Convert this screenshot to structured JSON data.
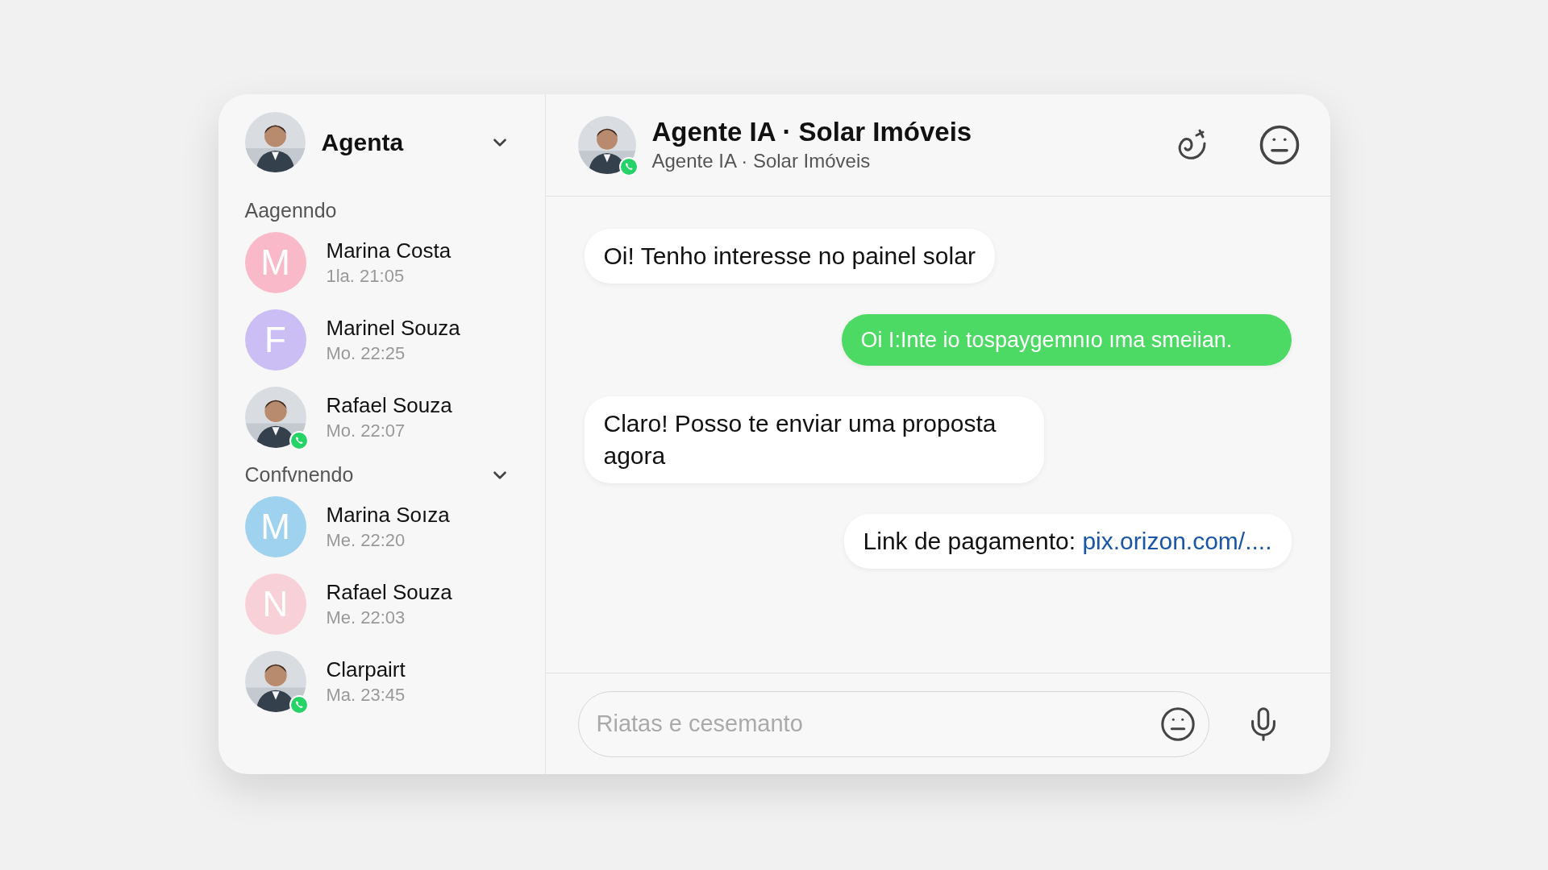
{
  "account": {
    "name": "Agenta",
    "expanded": true
  },
  "sections": [
    {
      "title": "Aagenndo",
      "contacts": [
        {
          "name": "Marina Costa",
          "time": "1la. 21:05",
          "kind": "letter",
          "initial": "M",
          "color": "#f9b9c8",
          "whatsapp": false
        },
        {
          "name": "Marinel Souza",
          "time": "Mo. 22:25",
          "kind": "letter",
          "initial": "F",
          "color": "#cbbef5",
          "whatsapp": false
        },
        {
          "name": "Rafael Souza",
          "time": "Mo. 22:07",
          "whatsapp": true
        }
      ]
    },
    {
      "title": "Confvnendo",
      "expanded": true,
      "contacts": [
        {
          "name": "Marina Soıza",
          "time": "Me. 22:20",
          "kind": "letter",
          "initial": "M",
          "color": "#9fd2ef",
          "whatsapp": false
        },
        {
          "name": "Rafael Souza",
          "time": "Me. 22:03",
          "kind": "letter",
          "initial": "N",
          "color": "#f8d0d8",
          "whatsapp": false
        },
        {
          "name": "Clarpairt",
          "time": "Ma. 23:45",
          "whatsapp": true
        }
      ]
    }
  ],
  "chat": {
    "title": "Agente IA · Solar Imóveis",
    "subtitle": "Agente IA · Solar Imóveis",
    "whatsapp": true
  },
  "messages": [
    {
      "kind": "incoming",
      "text": "Oi! Tenho interesse no painel solar",
      "color": "#ffffff"
    },
    {
      "kind": "outgoing",
      "text": "Oi I:Inte io tospaygemnıo ıma smeiian.",
      "color": "#4cd964"
    },
    {
      "kind": "incoming",
      "text": "Claro! Posso te enviar uma proposta agora",
      "color": "#ffffff"
    },
    {
      "kind": "outgoing",
      "text": "Link de pagamento:",
      "link": "pix.orizon.com/....",
      "color": "#ffffff"
    }
  ],
  "composer": {
    "placeholder": "Riatas e cesemanto"
  }
}
